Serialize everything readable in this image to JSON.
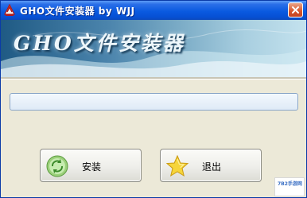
{
  "window": {
    "title": "GHO文件安装器  by WJJ"
  },
  "banner": {
    "title": "GHO文件安装器"
  },
  "progress": {
    "value": 0.0
  },
  "buttons": {
    "install_label": "安装",
    "exit_label": "退出"
  },
  "icons": {
    "app": "app-logo-icon",
    "close": "close-icon",
    "install": "refresh-icon",
    "exit": "star-icon"
  },
  "colors": {
    "titlebar": "#0a5ae0",
    "banner_dark": "#1f5a84",
    "banner_light": "#c4e2ee",
    "close": "#d8542a"
  },
  "watermark": {
    "text": "7B2手游网"
  }
}
